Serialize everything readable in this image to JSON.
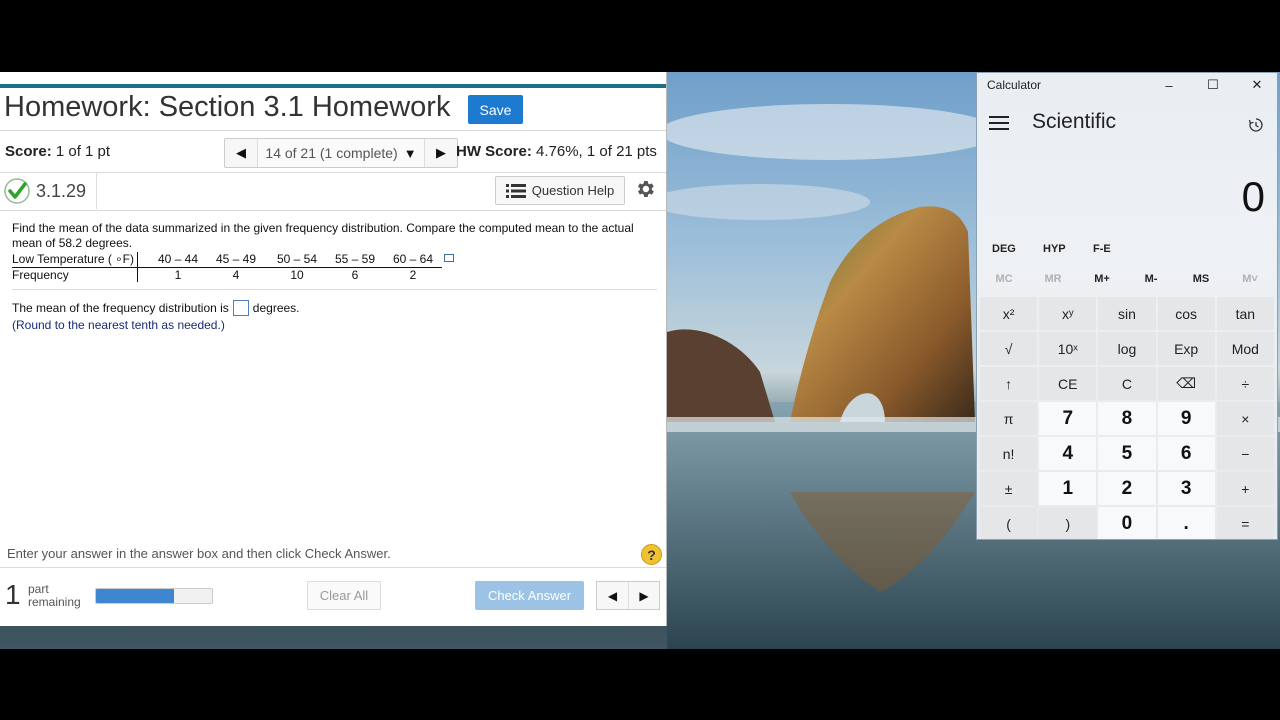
{
  "homework": {
    "title": "Homework: Section 3.1 Homework",
    "save_label": "Save",
    "score_label": "Score:",
    "score_value": " 1 of 1 pt",
    "question_nav": "14 of 21 (1 complete)",
    "hw_score_label": "HW Score:",
    "hw_score_value": " 4.76%, 1 of 21 pts",
    "question_id": "3.1.29",
    "question_help_label": "Question Help",
    "problem_text": "Find the mean of the data summarized in the given frequency distribution. Compare the computed mean to the actual mean of 58.2 degrees.",
    "table": {
      "row1_label": "Low Temperature ( ∘F)",
      "row2_label": "Frequency",
      "classes": [
        "40 – 44",
        "45 – 49",
        "50 – 54",
        "55 – 59",
        "60 – 64"
      ],
      "frequencies": [
        "1",
        "4",
        "10",
        "6",
        "2"
      ]
    },
    "answer_prefix": "The mean of the frequency distribution is",
    "answer_value": "",
    "answer_suffix": "degrees.",
    "round_note": "(Round to the nearest tenth as needed.)",
    "instructions": "Enter your answer in the answer box and then click Check Answer.",
    "help_symbol": "?",
    "parts_count": "1",
    "parts_label_1": "part",
    "parts_label_2": "remaining",
    "progress_fraction": 0.67,
    "clear_all_label": "Clear All",
    "check_answer_label": "Check Answer",
    "colors": {
      "accent": "#1c6f86",
      "save": "#1d7ad1",
      "progress": "#3f86d1",
      "check_answer": "#9cc2e5"
    }
  },
  "calculator": {
    "window_title": "Calculator",
    "minimize": "–",
    "maximize": "☐",
    "close": "✕",
    "mode": "Scientific",
    "display": "0",
    "angle_buttons": [
      "DEG",
      "HYP",
      "F-E"
    ],
    "memory_buttons": [
      "MC",
      "MR",
      "M+",
      "M-",
      "MS",
      "M˅"
    ],
    "keys": [
      "x²",
      "xʸ",
      "sin",
      "cos",
      "tan",
      "√",
      "10ˣ",
      "log",
      "Exp",
      "Mod",
      "↑",
      "CE",
      "C",
      "⌫",
      "÷",
      "π",
      "7",
      "8",
      "9",
      "×",
      "n!",
      "4",
      "5",
      "6",
      "−",
      "±",
      "1",
      "2",
      "3",
      "+",
      "(",
      ")",
      "0",
      ".",
      "="
    ]
  }
}
